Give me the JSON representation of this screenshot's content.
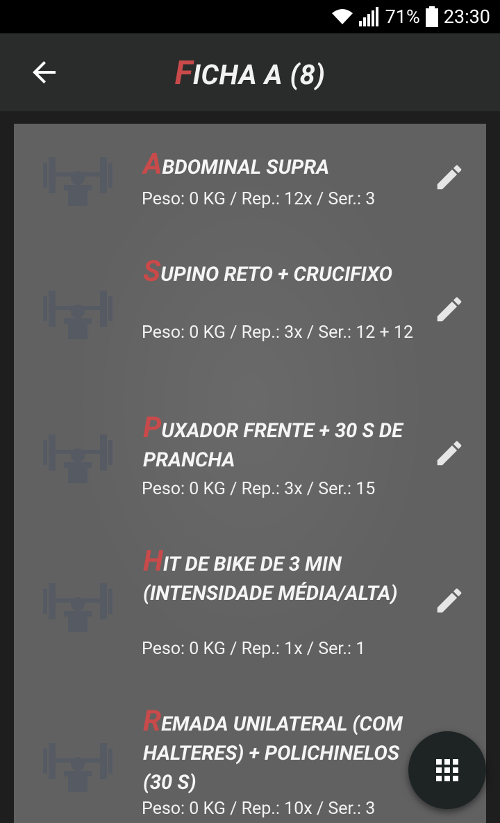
{
  "status": {
    "battery_percent": "71%",
    "time": "23:30"
  },
  "appbar": {
    "title_first": "F",
    "title_rest": "ICHA A (8)"
  },
  "colors": {
    "accent_red": "#c94a4a",
    "appbar": "#2a2b2b",
    "fab": "#1d2423"
  },
  "exercises": [
    {
      "first": "A",
      "rest": "bdominal supra",
      "meta": "Peso: 0 KG / Rep.: 12x / Ser.: 3"
    },
    {
      "first": "S",
      "rest": "upino reto + crucifixo",
      "meta": "Peso: 0 KG / Rep.: 3x / Ser.: 12 + 12"
    },
    {
      "first": "P",
      "rest": "uxador frente + 30 s de prancha",
      "meta": "Peso: 0 KG / Rep.: 3x / Ser.: 15"
    },
    {
      "first": "H",
      "rest": "it de bike de 3 min (intensidade média/alta)",
      "meta": "Peso: 0 KG / Rep.: 1x / Ser.: 1"
    },
    {
      "first": "R",
      "rest": "emada unilateral (com halteres) + polichinelos (30 s)",
      "meta": "Peso: 0 KG / Rep.: 10x / Ser.: 3"
    }
  ],
  "icons": {
    "back": "arrow-back-icon",
    "thumb": "bench-press-icon",
    "edit": "pencil-icon",
    "fab": "grid-icon"
  }
}
